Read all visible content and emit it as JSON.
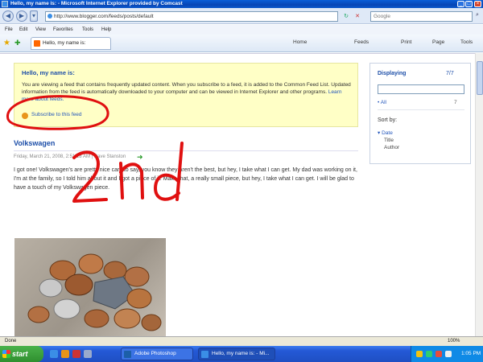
{
  "window": {
    "title": "Hello, my name is: - Microsoft Internet Explorer provided by Comcast",
    "controls": [
      "_",
      "□",
      "×"
    ]
  },
  "address_bar": {
    "url": "http://www.blogger.com/feeds/posts/default",
    "search_placeholder": "Google"
  },
  "menu": [
    "File",
    "Edit",
    "View",
    "Favorites",
    "Tools",
    "Help"
  ],
  "tab": {
    "label": "Hello, my name is:"
  },
  "command_bar": [
    "Home",
    "Feeds",
    "Print",
    "Page",
    "Tools"
  ],
  "feed_box": {
    "title": "Hello, my name is:",
    "description": "You are viewing a feed that contains frequently updated content. When you subscribe to a feed, it is added to the Common Feed List. Updated information from the feed is automatically downloaded to your computer and can be viewed in Internet Explorer and other programs.",
    "learn_more": "Learn more about feeds.",
    "subscribe_label": "Subscribe to this feed"
  },
  "post": {
    "title": "Volkswagen",
    "meta": "Friday, March 21, 2008, 2:51:18 AM | Dave Stanston",
    "body": "I got one! Volkswagen's are pretty nice cars to say, you know they aren't the best, but hey, I take what I can get. My dad was working on it, I'm at the family, so I told him about it and I got a piece of it. Make that, a really small piece, but hey, I take what I can get. I will be glad to have a touch of my Volkswagen piece."
  },
  "sidebar": {
    "heading": "Displaying",
    "count": "7/7",
    "all_label": "All",
    "all_count": "7",
    "sort_by": "Sort by:",
    "sort_options": [
      "Date",
      "Title",
      "Author"
    ]
  },
  "status": {
    "left": "Done",
    "zoom": "100%"
  },
  "taskbar": {
    "start": "start",
    "tasks": [
      "Adobe Photoshop",
      "Hello, my name is: - Mi..."
    ],
    "clock": "1:05 PM"
  },
  "annotation": {
    "text": "2nd",
    "color": "#e01010"
  }
}
